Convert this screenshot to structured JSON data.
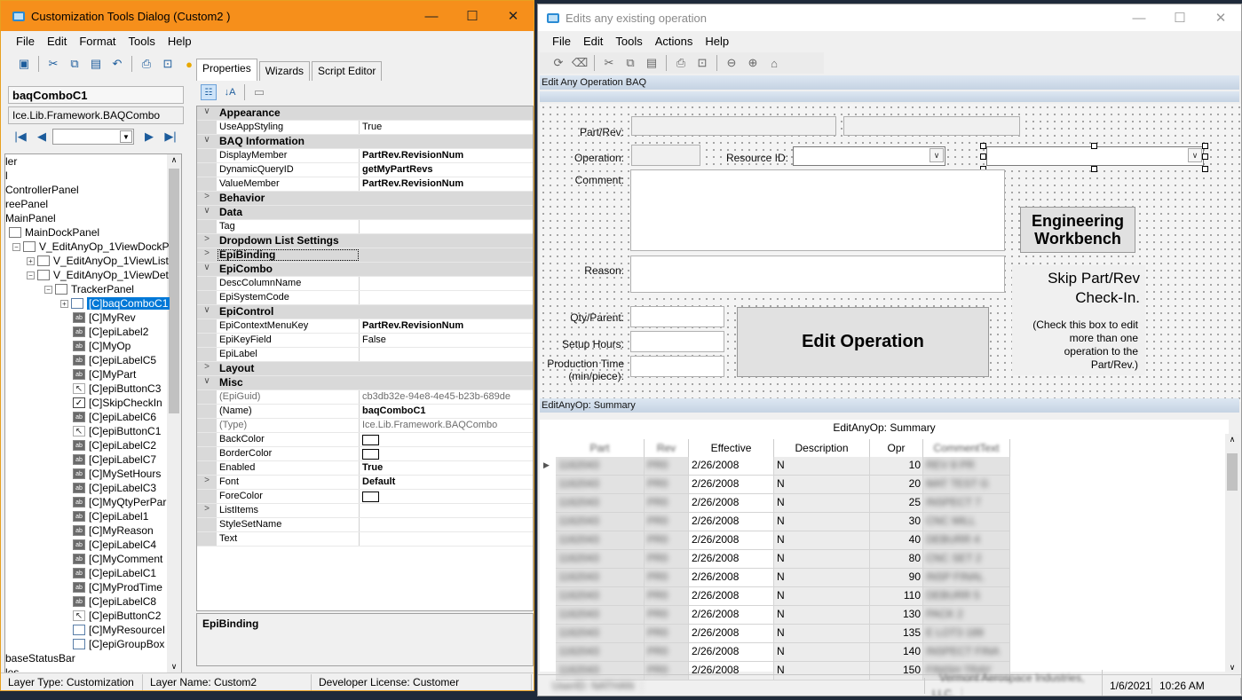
{
  "left": {
    "title": "Customization Tools Dialog  (Custom2 )",
    "menu": [
      "File",
      "Edit",
      "Format",
      "Tools",
      "Help"
    ],
    "selected_name": "baqComboC1",
    "selected_type": "Ice.Lib.Framework.BAQCombo",
    "tree": [
      {
        "label": "ler",
        "icon": "none",
        "expander": ""
      },
      {
        "label": "l",
        "icon": "none",
        "expander": ""
      },
      {
        "label": "ControllerPanel",
        "icon": "none",
        "expander": ""
      },
      {
        "label": "reePanel",
        "icon": "none",
        "expander": ""
      },
      {
        "label": "MainPanel",
        "icon": "none",
        "expander": ""
      },
      {
        "label": "MainDockPanel",
        "icon": "box",
        "expander": ""
      },
      {
        "label": "V_EditAnyOp_1ViewDockP",
        "icon": "box",
        "expander": "−"
      },
      {
        "label": "V_EditAnyOp_1ViewList",
        "icon": "box",
        "expander": "+"
      },
      {
        "label": "V_EditAnyOp_1ViewDet",
        "icon": "box",
        "expander": "−"
      },
      {
        "label": "TrackerPanel",
        "icon": "box",
        "expander": "−"
      },
      {
        "label": "[C]baqComboC1",
        "icon": "cb",
        "expander": "+"
      },
      {
        "label": "[C]MyRev",
        "icon": "ab",
        "expander": ""
      },
      {
        "label": "[C]epiLabel2",
        "icon": "ab",
        "expander": ""
      },
      {
        "label": "[C]MyOp",
        "icon": "ab",
        "expander": ""
      },
      {
        "label": "[C]epiLabelC5",
        "icon": "ab",
        "expander": ""
      },
      {
        "label": "[C]MyPart",
        "icon": "ab",
        "expander": ""
      },
      {
        "label": "[C]epiButtonC3",
        "icon": "btn",
        "expander": ""
      },
      {
        "label": "[C]SkipCheckIn",
        "icon": "chk",
        "expander": ""
      },
      {
        "label": "[C]epiLabelC6",
        "icon": "ab",
        "expander": ""
      },
      {
        "label": "[C]epiButtonC1",
        "icon": "btn",
        "expander": ""
      },
      {
        "label": "[C]epiLabelC2",
        "icon": "ab",
        "expander": ""
      },
      {
        "label": "[C]epiLabelC7",
        "icon": "ab",
        "expander": ""
      },
      {
        "label": "[C]MySetHours",
        "icon": "ab",
        "expander": ""
      },
      {
        "label": "[C]epiLabelC3",
        "icon": "ab",
        "expander": ""
      },
      {
        "label": "[C]MyQtyPerPar",
        "icon": "ab",
        "expander": ""
      },
      {
        "label": "[C]epiLabel1",
        "icon": "ab",
        "expander": ""
      },
      {
        "label": "[C]MyReason",
        "icon": "ab",
        "expander": ""
      },
      {
        "label": "[C]epiLabelC4",
        "icon": "ab",
        "expander": ""
      },
      {
        "label": "[C]MyComment",
        "icon": "ab",
        "expander": ""
      },
      {
        "label": "[C]epiLabelC1",
        "icon": "ab",
        "expander": ""
      },
      {
        "label": "[C]MyProdTime",
        "icon": "ab",
        "expander": ""
      },
      {
        "label": "[C]epiLabelC8",
        "icon": "ab",
        "expander": ""
      },
      {
        "label": "[C]epiButtonC2",
        "icon": "btn",
        "expander": ""
      },
      {
        "label": "[C]MyResourceI",
        "icon": "cb",
        "expander": ""
      },
      {
        "label": "[C]epiGroupBox",
        "icon": "cb",
        "expander": ""
      },
      {
        "label": "baseStatusBar",
        "icon": "none",
        "expander": ""
      },
      {
        "label": "les",
        "icon": "none",
        "expander": ""
      }
    ],
    "tabs": [
      "Properties",
      "Wizards",
      "Script Editor"
    ],
    "props": [
      {
        "cat": true,
        "exp": "∨",
        "name": "Appearance"
      },
      {
        "name": "UseAppStyling",
        "value": "True"
      },
      {
        "cat": true,
        "exp": "∨",
        "name": "BAQ Information"
      },
      {
        "name": "DisplayMember",
        "value": "PartRev.RevisionNum",
        "bold": true
      },
      {
        "name": "DynamicQueryID",
        "value": "getMyPartRevs",
        "bold": true
      },
      {
        "name": "ValueMember",
        "value": "PartRev.RevisionNum",
        "bold": true
      },
      {
        "cat": true,
        "exp": ">",
        "name": "Behavior"
      },
      {
        "cat": true,
        "exp": "∨",
        "name": "Data"
      },
      {
        "name": "Tag",
        "value": ""
      },
      {
        "cat": true,
        "exp": ">",
        "name": "Dropdown List Settings"
      },
      {
        "cat": true,
        "exp": ">",
        "name": "EpiBinding"
      },
      {
        "cat": true,
        "exp": "∨",
        "name": "EpiCombo"
      },
      {
        "name": "DescColumnName",
        "value": ""
      },
      {
        "name": "EpiSystemCode",
        "value": ""
      },
      {
        "cat": true,
        "exp": "∨",
        "name": "EpiControl"
      },
      {
        "name": "EpiContextMenuKey",
        "value": "PartRev.RevisionNum",
        "bold": true
      },
      {
        "name": "EpiKeyField",
        "value": "False"
      },
      {
        "name": "EpiLabel",
        "value": ""
      },
      {
        "cat": true,
        "exp": ">",
        "name": "Layout"
      },
      {
        "cat": true,
        "exp": "∨",
        "name": "Misc"
      },
      {
        "name": "(EpiGuid)",
        "value": "cb3db32e-94e8-4e45-b23b-689de",
        "gray": true
      },
      {
        "name": "(Name)",
        "value": "baqComboC1",
        "bold": true
      },
      {
        "name": "(Type)",
        "value": "Ice.Lib.Framework.BAQCombo",
        "gray": true
      },
      {
        "name": "BackColor",
        "value": "",
        "swatch": true
      },
      {
        "name": "BorderColor",
        "value": "",
        "swatch": true
      },
      {
        "name": "Enabled",
        "value": "True",
        "bold": true
      },
      {
        "name": "Font",
        "value": "Default",
        "bold": true,
        "exp": ">"
      },
      {
        "name": "ForeColor",
        "value": "",
        "swatch": true
      },
      {
        "name": "ListItems",
        "value": "",
        "exp": ">"
      },
      {
        "name": "StyleSetName",
        "value": ""
      },
      {
        "name": "Text",
        "value": ""
      }
    ],
    "desc_title": "EpiBinding",
    "status": [
      "Layer Type:  Customization",
      "Layer Name:  Custom2",
      "Developer License:  Customer"
    ]
  },
  "right": {
    "title": "Edits any existing operation",
    "menu": [
      "File",
      "Edit",
      "Tools",
      "Actions",
      "Help"
    ],
    "panel1": "Edit Any Operation BAQ",
    "labels": {
      "partrev": "Part/Rev:",
      "operation": "Operation:",
      "resource": "Resource ID:",
      "comment": "Comment:",
      "reason": "Reason:",
      "qty": "Qty/Parent:",
      "setup": "Setup Hours:",
      "prod": "Production Time (min/piece):"
    },
    "eng_btn": "Engineering Workbench",
    "skip_title": "Skip Part/Rev Check-In.",
    "skip_note": "(Check this box to edit more than one operation to the Part/Rev.)",
    "edit_btn": "Edit Operation",
    "panel2": "EditAnyOp: Summary",
    "grid_title": "EditAnyOp: Summary",
    "columns": [
      "Part",
      "Rev",
      "Effective",
      "Description",
      "Opr",
      "CommentText"
    ],
    "rows": [
      {
        "part": "1162043",
        "rev": "PR0",
        "eff": "2/26/2008",
        "desc": "N",
        "opr": "10",
        "cmt": "REV 8     PR"
      },
      {
        "part": "1162043",
        "rev": "PR0",
        "eff": "2/26/2008",
        "desc": "N",
        "opr": "20",
        "cmt": "MAT TEST  G"
      },
      {
        "part": "1162043",
        "rev": "PR0",
        "eff": "2/26/2008",
        "desc": "N",
        "opr": "25",
        "cmt": "INSPECT 7"
      },
      {
        "part": "1162043",
        "rev": "PR0",
        "eff": "2/26/2008",
        "desc": "N",
        "opr": "30",
        "cmt": "CNC MILL"
      },
      {
        "part": "1162043",
        "rev": "PR0",
        "eff": "2/26/2008",
        "desc": "N",
        "opr": "40",
        "cmt": "DEBURR 4"
      },
      {
        "part": "1162043",
        "rev": "PR0",
        "eff": "2/26/2008",
        "desc": "N",
        "opr": "80",
        "cmt": "CNC SET 2"
      },
      {
        "part": "1162043",
        "rev": "PR0",
        "eff": "2/26/2008",
        "desc": "N",
        "opr": "90",
        "cmt": "INSP FINAL"
      },
      {
        "part": "1162043",
        "rev": "PR0",
        "eff": "2/26/2008",
        "desc": "N",
        "opr": "110",
        "cmt": "DEBURR 5"
      },
      {
        "part": "1162043",
        "rev": "PR0",
        "eff": "2/26/2008",
        "desc": "N",
        "opr": "130",
        "cmt": "PACK 2"
      },
      {
        "part": "1162043",
        "rev": "PR0",
        "eff": "2/26/2008",
        "desc": "N",
        "opr": "135",
        "cmt": "E LOT3 189"
      },
      {
        "part": "1162043",
        "rev": "PR0",
        "eff": "2/26/2008",
        "desc": "N",
        "opr": "140",
        "cmt": "INSPECT FINA"
      },
      {
        "part": "1162043",
        "rev": "PR0",
        "eff": "2/26/2008",
        "desc": "N",
        "opr": "150",
        "cmt": "FINISH TRAY"
      }
    ],
    "status": [
      "UserID:  NATHAN",
      "Vermont Aerospace Industries, LLC.",
      "1/6/2021",
      "10:26 AM"
    ]
  }
}
